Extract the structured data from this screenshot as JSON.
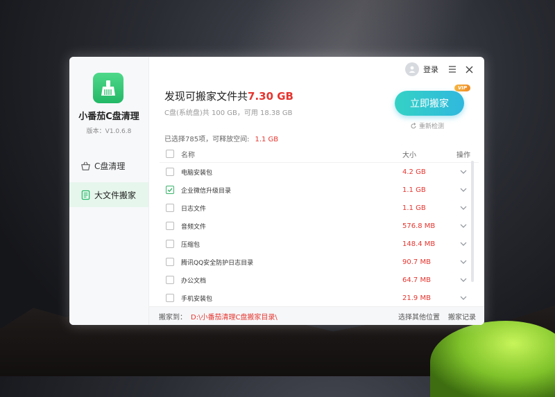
{
  "app": {
    "name": "小番茄C盘清理",
    "version": "版本：V1.0.6.8"
  },
  "sidebar": {
    "items": [
      {
        "label": "C盘清理",
        "icon": "basket-icon",
        "active": false
      },
      {
        "label": "大文件搬家",
        "icon": "document-list-icon",
        "active": true
      }
    ]
  },
  "topbar": {
    "login": "登录"
  },
  "summary": {
    "headline_prefix": "发现可搬家文件共",
    "headline_size": "7.30 GB",
    "disk_info": "C盘(系统盘)共 100 GB，可用 18.38 GB",
    "selected_text": "已选择785项，可释放空间:",
    "selected_size": "1.1 GB"
  },
  "actions": {
    "move_now": "立即搬家",
    "vip_badge": "VIP",
    "rescan": "重新检测"
  },
  "table": {
    "headers": {
      "name": "名称",
      "size": "大小",
      "action": "操作"
    },
    "rows": [
      {
        "name": "电脑安装包",
        "size": "4.2 GB",
        "checked": false
      },
      {
        "name": "企业微信升级目录",
        "size": "1.1 GB",
        "checked": true
      },
      {
        "name": "日志文件",
        "size": "1.1 GB",
        "checked": false
      },
      {
        "name": "音频文件",
        "size": "576.8 MB",
        "checked": false
      },
      {
        "name": "压缩包",
        "size": "148.4 MB",
        "checked": false
      },
      {
        "name": "腾讯QQ安全防护日志目录",
        "size": "90.7 MB",
        "checked": false
      },
      {
        "name": "办公文档",
        "size": "64.7 MB",
        "checked": false
      },
      {
        "name": "手机安装包",
        "size": "21.9 MB",
        "checked": false
      }
    ]
  },
  "footer": {
    "label": "搬家到：",
    "path": "D:\\小番茄清理C盘搬家目录\\",
    "choose_other": "选择其他位置",
    "history": "搬家记录"
  },
  "colors": {
    "accent": "#e5352f",
    "brand": "#22b866",
    "button": "#2fb8de"
  }
}
